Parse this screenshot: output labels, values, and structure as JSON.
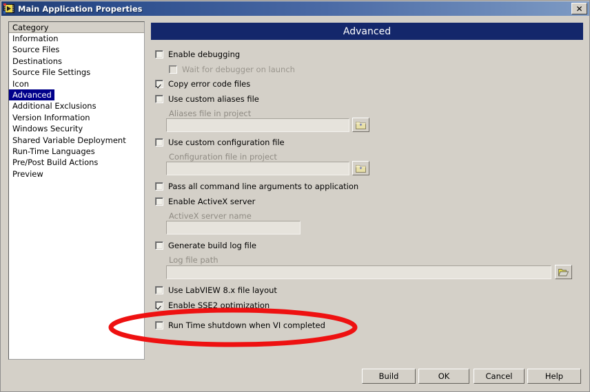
{
  "window": {
    "title": "Main Application Properties",
    "icon": "labview-vi-icon",
    "close_label": "✕"
  },
  "sidebar": {
    "header": "Category",
    "selected": "Advanced",
    "items": [
      {
        "label": "Information"
      },
      {
        "label": "Source Files"
      },
      {
        "label": "Destinations"
      },
      {
        "label": "Source File Settings"
      },
      {
        "label": "Icon"
      },
      {
        "label": "Advanced"
      },
      {
        "label": "Additional Exclusions"
      },
      {
        "label": "Version Information"
      },
      {
        "label": "Windows Security"
      },
      {
        "label": "Shared Variable Deployment"
      },
      {
        "label": "Run-Time Languages"
      },
      {
        "label": "Pre/Post Build Actions"
      },
      {
        "label": "Preview"
      }
    ]
  },
  "panel": {
    "header": "Advanced",
    "controls": {
      "enable_debugging": {
        "label": "Enable debugging",
        "checked": false
      },
      "wait_for_debugger": {
        "label": "Wait for debugger on launch",
        "checked": false,
        "disabled": true
      },
      "copy_error_code_files": {
        "label": "Copy error code files",
        "checked": true
      },
      "use_custom_aliases": {
        "label": "Use custom aliases file",
        "checked": false
      },
      "aliases_field_label": "Aliases file in project",
      "aliases_field_value": "",
      "aliases_browse": "browse-folder-icon",
      "use_custom_config": {
        "label": "Use custom configuration file",
        "checked": false
      },
      "config_field_label": "Configuration file in project",
      "config_field_value": "",
      "config_browse": "browse-folder-icon",
      "pass_cmdline_args": {
        "label": "Pass all command line arguments to application",
        "checked": false
      },
      "enable_activex": {
        "label": "Enable ActiveX server",
        "checked": false
      },
      "activex_field_label": "ActiveX server name",
      "activex_field_value": "",
      "generate_build_log": {
        "label": "Generate build log file",
        "checked": false
      },
      "log_field_label": "Log file path",
      "log_field_value": "",
      "log_browse": "open-folder-icon",
      "use_labview8_layout": {
        "label": "Use LabVIEW 8.x file layout",
        "checked": false
      },
      "enable_sse2": {
        "label": "Enable SSE2 optimization",
        "checked": true
      },
      "run_time_shutdown": {
        "label": "Run Time shutdown when VI completed",
        "checked": false
      }
    }
  },
  "footer": {
    "build": "Build",
    "ok": "OK",
    "cancel": "Cancel",
    "help": "Help"
  },
  "annotation": {
    "shape": "ellipse",
    "color": "#ee1111",
    "target": "Run Time shutdown when VI completed"
  }
}
